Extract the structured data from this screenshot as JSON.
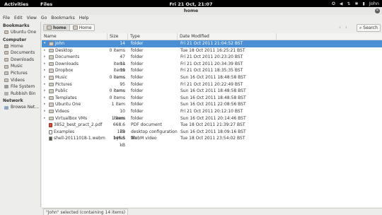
{
  "topbar": {
    "activities": "Activities",
    "app": "Files",
    "clock": "Fri 21 Oct, 21:07",
    "user": "John"
  },
  "window": {
    "title": "home"
  },
  "menu": [
    "File",
    "Edit",
    "View",
    "Go",
    "Bookmarks",
    "Help"
  ],
  "sidebar": {
    "bookmarks_header": "Bookmarks",
    "bookmarks": [
      {
        "label": "Ubuntu One",
        "icon": "folder-icon"
      }
    ],
    "computer_header": "Computer",
    "computer": [
      {
        "label": "Home",
        "icon": "home-icon"
      },
      {
        "label": "Documents",
        "icon": "folder-icon"
      },
      {
        "label": "Downloads",
        "icon": "folder-icon"
      },
      {
        "label": "Music",
        "icon": "folder-icon"
      },
      {
        "label": "Pictures",
        "icon": "folder-icon"
      },
      {
        "label": "Videos",
        "icon": "folder-icon"
      },
      {
        "label": "File System",
        "icon": "drive-icon"
      },
      {
        "label": "Rubbish Bin",
        "icon": "trash-icon"
      }
    ],
    "network_header": "Network",
    "network": [
      {
        "label": "Browse Net...",
        "icon": "network-icon"
      }
    ]
  },
  "toolbar": {
    "crumb_home": "home",
    "crumb_folder": "Home",
    "search_label": "Search"
  },
  "columns": {
    "name": "Name",
    "size": "Size",
    "type": "Type",
    "date": "Date Modified"
  },
  "files": [
    {
      "name": "John",
      "size": "14 items",
      "type": "folder",
      "date": "Fri 21 Oct 2011 21:04:52 BST",
      "icon": "folder",
      "selected": true
    },
    {
      "name": "Desktop",
      "size": "0 items",
      "type": "folder",
      "date": "Tue 18 Oct 2011 16:25:21 BST",
      "icon": "folder"
    },
    {
      "name": "Documents",
      "size": "47 items",
      "type": "folder",
      "date": "Fri 21 Oct 2011 20:23:20 BST",
      "icon": "folder"
    },
    {
      "name": "Downloads",
      "size": "11 items",
      "type": "folder",
      "date": "Fri 21 Oct 2011 20:34:39 BST",
      "icon": "folder"
    },
    {
      "name": "Dropbox",
      "size": "19 items",
      "type": "folder",
      "date": "Fri 21 Oct 2011 18:35:35 BST",
      "icon": "folder"
    },
    {
      "name": "Music",
      "size": "0 items",
      "type": "folder",
      "date": "Sun 16 Oct 2011 18:48:58 BST",
      "icon": "folder"
    },
    {
      "name": "Pictures",
      "size": "95 items",
      "type": "folder",
      "date": "Fri 21 Oct 2011 20:22:49 BST",
      "icon": "folder"
    },
    {
      "name": "Public",
      "size": "0 items",
      "type": "folder",
      "date": "Sun 16 Oct 2011 18:48:58 BST",
      "icon": "folder"
    },
    {
      "name": "Templates",
      "size": "0 items",
      "type": "folder",
      "date": "Sun 16 Oct 2011 18:48:58 BST",
      "icon": "folder"
    },
    {
      "name": "Ubuntu One",
      "size": "1 item",
      "type": "folder",
      "date": "Sun 16 Oct 2011 22:08:56 BST",
      "icon": "folder"
    },
    {
      "name": "Videos",
      "size": "10 items",
      "type": "folder",
      "date": "Fri 21 Oct 2011 20:12:10 BST",
      "icon": "folder"
    },
    {
      "name": "VirtualBox VMs",
      "size": "1 item",
      "type": "folder",
      "date": "Sun 16 Oct 2011 20:14:46 BST",
      "icon": "folder"
    },
    {
      "name": "3852_best_pract_2.pdf",
      "size": "668.6 kB",
      "type": "PDF document",
      "date": "Tue 18 Oct 2011 21:39:27 BST",
      "icon": "pdf"
    },
    {
      "name": "Examples",
      "size": "179 bytes",
      "type": "desktop configuration file",
      "date": "Sun 16 Oct 2011 18:09:16 BST",
      "icon": "doc"
    },
    {
      "name": "shell-20111018-1.webm",
      "size": "146.5 kB",
      "type": "WebM video",
      "date": "Tue 18 Oct 2011 23:54:02 BST",
      "icon": "media"
    }
  ],
  "status": "\"John\" selected (containing 14 items)"
}
